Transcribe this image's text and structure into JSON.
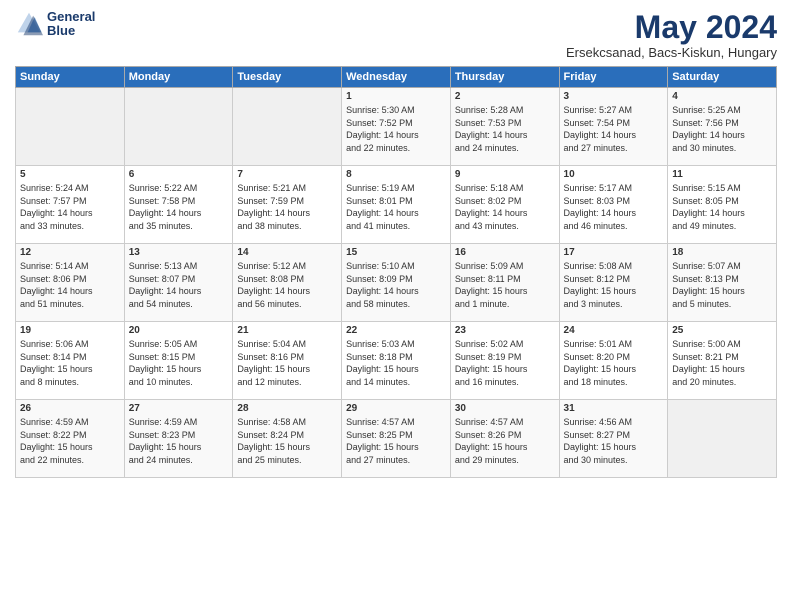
{
  "logo": {
    "line1": "General",
    "line2": "Blue"
  },
  "title": "May 2024",
  "location": "Ersekcsanad, Bacs-Kiskun, Hungary",
  "weekdays": [
    "Sunday",
    "Monday",
    "Tuesday",
    "Wednesday",
    "Thursday",
    "Friday",
    "Saturday"
  ],
  "weeks": [
    [
      {
        "day": "",
        "info": ""
      },
      {
        "day": "",
        "info": ""
      },
      {
        "day": "",
        "info": ""
      },
      {
        "day": "1",
        "info": "Sunrise: 5:30 AM\nSunset: 7:52 PM\nDaylight: 14 hours\nand 22 minutes."
      },
      {
        "day": "2",
        "info": "Sunrise: 5:28 AM\nSunset: 7:53 PM\nDaylight: 14 hours\nand 24 minutes."
      },
      {
        "day": "3",
        "info": "Sunrise: 5:27 AM\nSunset: 7:54 PM\nDaylight: 14 hours\nand 27 minutes."
      },
      {
        "day": "4",
        "info": "Sunrise: 5:25 AM\nSunset: 7:56 PM\nDaylight: 14 hours\nand 30 minutes."
      }
    ],
    [
      {
        "day": "5",
        "info": "Sunrise: 5:24 AM\nSunset: 7:57 PM\nDaylight: 14 hours\nand 33 minutes."
      },
      {
        "day": "6",
        "info": "Sunrise: 5:22 AM\nSunset: 7:58 PM\nDaylight: 14 hours\nand 35 minutes."
      },
      {
        "day": "7",
        "info": "Sunrise: 5:21 AM\nSunset: 7:59 PM\nDaylight: 14 hours\nand 38 minutes."
      },
      {
        "day": "8",
        "info": "Sunrise: 5:19 AM\nSunset: 8:01 PM\nDaylight: 14 hours\nand 41 minutes."
      },
      {
        "day": "9",
        "info": "Sunrise: 5:18 AM\nSunset: 8:02 PM\nDaylight: 14 hours\nand 43 minutes."
      },
      {
        "day": "10",
        "info": "Sunrise: 5:17 AM\nSunset: 8:03 PM\nDaylight: 14 hours\nand 46 minutes."
      },
      {
        "day": "11",
        "info": "Sunrise: 5:15 AM\nSunset: 8:05 PM\nDaylight: 14 hours\nand 49 minutes."
      }
    ],
    [
      {
        "day": "12",
        "info": "Sunrise: 5:14 AM\nSunset: 8:06 PM\nDaylight: 14 hours\nand 51 minutes."
      },
      {
        "day": "13",
        "info": "Sunrise: 5:13 AM\nSunset: 8:07 PM\nDaylight: 14 hours\nand 54 minutes."
      },
      {
        "day": "14",
        "info": "Sunrise: 5:12 AM\nSunset: 8:08 PM\nDaylight: 14 hours\nand 56 minutes."
      },
      {
        "day": "15",
        "info": "Sunrise: 5:10 AM\nSunset: 8:09 PM\nDaylight: 14 hours\nand 58 minutes."
      },
      {
        "day": "16",
        "info": "Sunrise: 5:09 AM\nSunset: 8:11 PM\nDaylight: 15 hours\nand 1 minute."
      },
      {
        "day": "17",
        "info": "Sunrise: 5:08 AM\nSunset: 8:12 PM\nDaylight: 15 hours\nand 3 minutes."
      },
      {
        "day": "18",
        "info": "Sunrise: 5:07 AM\nSunset: 8:13 PM\nDaylight: 15 hours\nand 5 minutes."
      }
    ],
    [
      {
        "day": "19",
        "info": "Sunrise: 5:06 AM\nSunset: 8:14 PM\nDaylight: 15 hours\nand 8 minutes."
      },
      {
        "day": "20",
        "info": "Sunrise: 5:05 AM\nSunset: 8:15 PM\nDaylight: 15 hours\nand 10 minutes."
      },
      {
        "day": "21",
        "info": "Sunrise: 5:04 AM\nSunset: 8:16 PM\nDaylight: 15 hours\nand 12 minutes."
      },
      {
        "day": "22",
        "info": "Sunrise: 5:03 AM\nSunset: 8:18 PM\nDaylight: 15 hours\nand 14 minutes."
      },
      {
        "day": "23",
        "info": "Sunrise: 5:02 AM\nSunset: 8:19 PM\nDaylight: 15 hours\nand 16 minutes."
      },
      {
        "day": "24",
        "info": "Sunrise: 5:01 AM\nSunset: 8:20 PM\nDaylight: 15 hours\nand 18 minutes."
      },
      {
        "day": "25",
        "info": "Sunrise: 5:00 AM\nSunset: 8:21 PM\nDaylight: 15 hours\nand 20 minutes."
      }
    ],
    [
      {
        "day": "26",
        "info": "Sunrise: 4:59 AM\nSunset: 8:22 PM\nDaylight: 15 hours\nand 22 minutes."
      },
      {
        "day": "27",
        "info": "Sunrise: 4:59 AM\nSunset: 8:23 PM\nDaylight: 15 hours\nand 24 minutes."
      },
      {
        "day": "28",
        "info": "Sunrise: 4:58 AM\nSunset: 8:24 PM\nDaylight: 15 hours\nand 25 minutes."
      },
      {
        "day": "29",
        "info": "Sunrise: 4:57 AM\nSunset: 8:25 PM\nDaylight: 15 hours\nand 27 minutes."
      },
      {
        "day": "30",
        "info": "Sunrise: 4:57 AM\nSunset: 8:26 PM\nDaylight: 15 hours\nand 29 minutes."
      },
      {
        "day": "31",
        "info": "Sunrise: 4:56 AM\nSunset: 8:27 PM\nDaylight: 15 hours\nand 30 minutes."
      },
      {
        "day": "",
        "info": ""
      }
    ]
  ]
}
